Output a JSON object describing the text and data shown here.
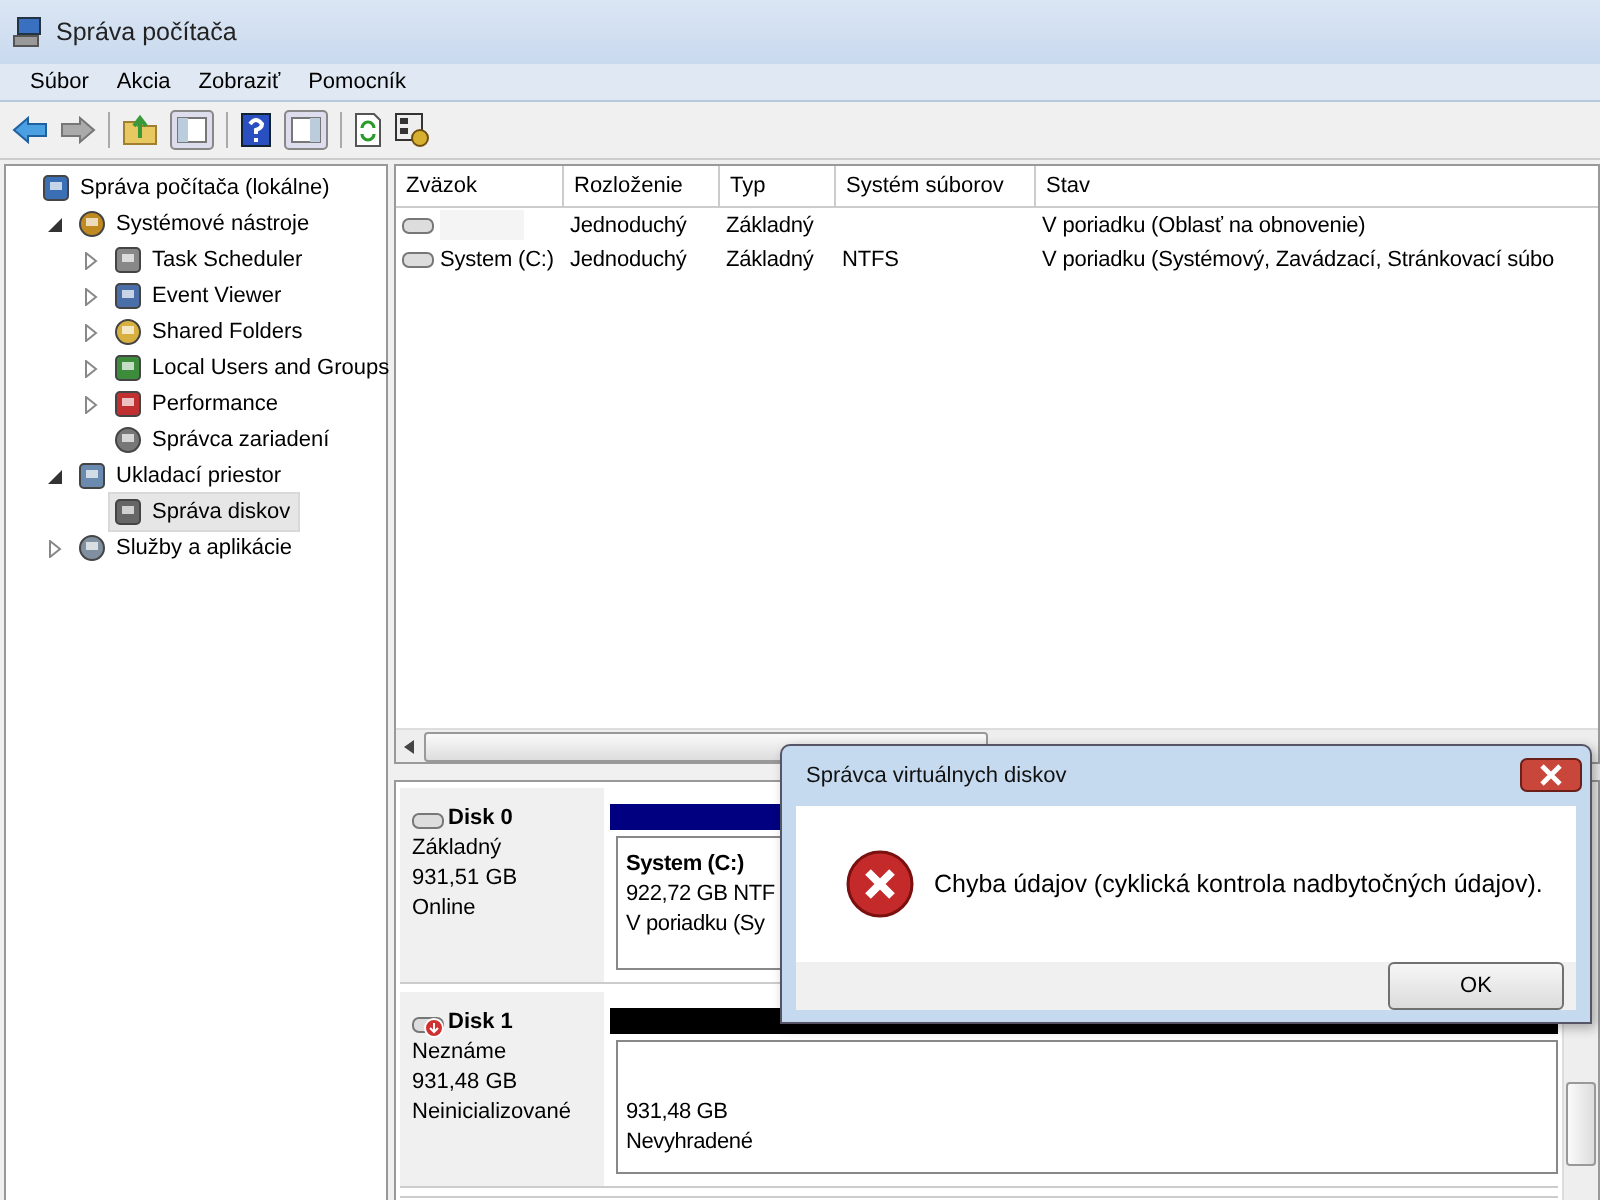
{
  "window": {
    "title": "Správa počítača"
  },
  "menu": [
    "Súbor",
    "Akcia",
    "Zobraziť",
    "Pomocník"
  ],
  "tree": [
    {
      "label": "Správa počítača (lokálne)",
      "kind": "root",
      "selected": false,
      "children": [
        {
          "label": "Systémové nástroje",
          "kind": "branch",
          "expanded": true,
          "selected": false,
          "children": [
            {
              "label": "Task Scheduler",
              "kind": "branch",
              "expanded": false,
              "selected": false
            },
            {
              "label": "Event Viewer",
              "kind": "branch",
              "expanded": false,
              "selected": false
            },
            {
              "label": "Shared Folders",
              "kind": "branch",
              "expanded": false,
              "selected": false
            },
            {
              "label": "Local Users and Groups",
              "kind": "branch",
              "expanded": false,
              "selected": false
            },
            {
              "label": "Performance",
              "kind": "branch",
              "expanded": false,
              "selected": false
            },
            {
              "label": "Správca zariadení",
              "kind": "leaf",
              "selected": false
            }
          ]
        },
        {
          "label": "Ukladací priestor",
          "kind": "branch",
          "expanded": true,
          "selected": false,
          "children": [
            {
              "label": "Správa diskov",
              "kind": "leaf",
              "selected": true
            }
          ]
        },
        {
          "label": "Služby a aplikácie",
          "kind": "branch",
          "expanded": false,
          "selected": false
        }
      ]
    }
  ],
  "table": {
    "columns": [
      "Zväzok",
      "Rozloženie",
      "Typ",
      "Systém súborov",
      "Stav"
    ],
    "rows": [
      [
        "",
        "Jednoduchý",
        "Základný",
        "",
        "V poriadku (Oblasť na obnovenie)"
      ],
      [
        "System (C:)",
        "Jednoduchý",
        "Základný",
        "NTFS",
        "V poriadku (Systémový, Zavádzací, Stránkovací súbo"
      ]
    ]
  },
  "disks": [
    {
      "name": "Disk 0",
      "lines": [
        "Základný",
        "931,51 GB",
        "Online"
      ],
      "unknown": false,
      "partition": {
        "color": "#000080",
        "name": "System  (C:)",
        "lines": [
          "922,72 GB NTF",
          "V poriadku (Sy"
        ]
      }
    },
    {
      "name": "Disk 1",
      "lines": [
        "Neznáme",
        "931,48 GB",
        "Neinicializované"
      ],
      "unknown": true,
      "partition": {
        "color": "#000000",
        "lines": [
          "931,48 GB",
          "Nevyhradené"
        ]
      }
    }
  ],
  "dialog": {
    "title": "Správca virtuálnych diskov",
    "message": "Chyba údajov (cyklická kontrola nadbytočných údajov).",
    "button": "OK"
  }
}
